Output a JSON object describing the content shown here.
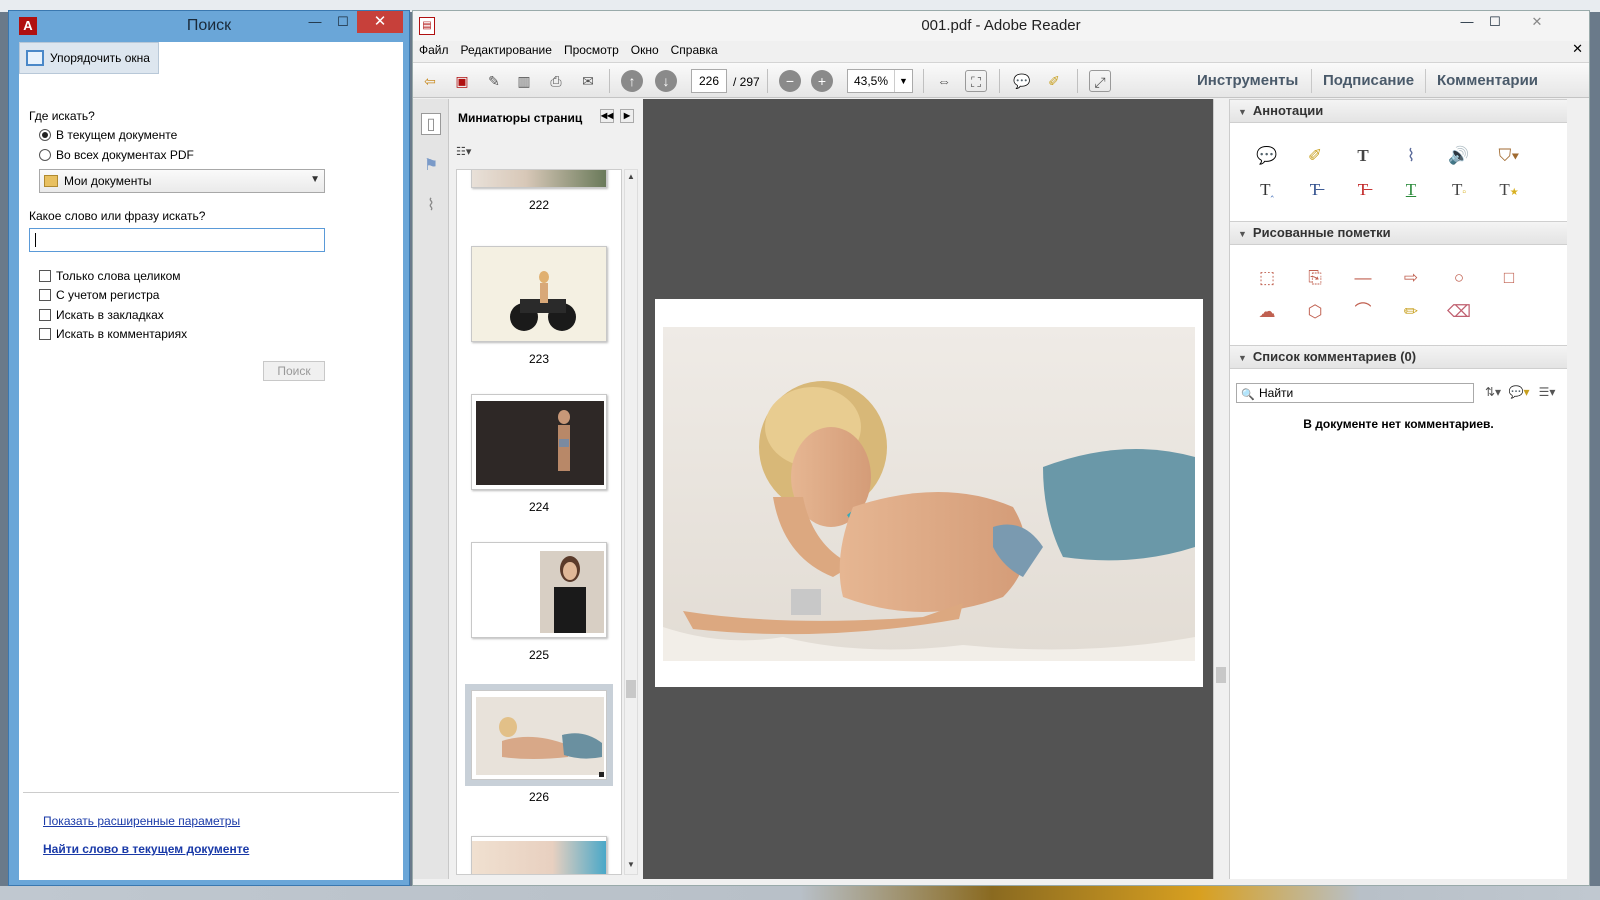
{
  "search_window": {
    "title": "Поиск",
    "arrange_label": "Упорядочить окна",
    "where_label": "Где искать?",
    "radio_current": "В текущем документе",
    "radio_all": "Во всех документах PDF",
    "folder_value": "Мои документы",
    "phrase_label": "Какое слово или фразу искать?",
    "search_value": "",
    "options": [
      "Только слова целиком",
      "С учетом регистра",
      "Искать в закладках",
      "Искать в комментариях"
    ],
    "search_button": "Поиск",
    "link_advanced": "Показать расширенные параметры",
    "link_find": "Найти слово в текущем документе",
    "close_glyph": "✕",
    "minimize_glyph": "—",
    "maximize_glyph": "☐"
  },
  "reader": {
    "title": "001.pdf - Adobe Reader",
    "menu": [
      "Файл",
      "Редактирование",
      "Просмотр",
      "Окно",
      "Справка"
    ],
    "current_page": "226",
    "total_pages": "/ 297",
    "zoom": "43,5%",
    "tabs": [
      "Инструменты",
      "Подписание",
      "Комментарии"
    ],
    "thumbnails_title": "Миниатюры страниц",
    "thumbnails": [
      {
        "page": "222"
      },
      {
        "page": "223"
      },
      {
        "page": "224"
      },
      {
        "page": "225"
      },
      {
        "page": "226",
        "selected": true
      }
    ],
    "right_panel": {
      "annotations_title": "Аннотации",
      "drawing_title": "Рисованные пометки",
      "comments_title": "Список комментариев (0)",
      "find_placeholder": "Найти",
      "no_comments": "В документе нет комментариев."
    },
    "doc_close": "✕"
  },
  "colors": {
    "accent_blue": "#6aa6d8",
    "close_red": "#c7403a",
    "doc_background": "#535353"
  }
}
